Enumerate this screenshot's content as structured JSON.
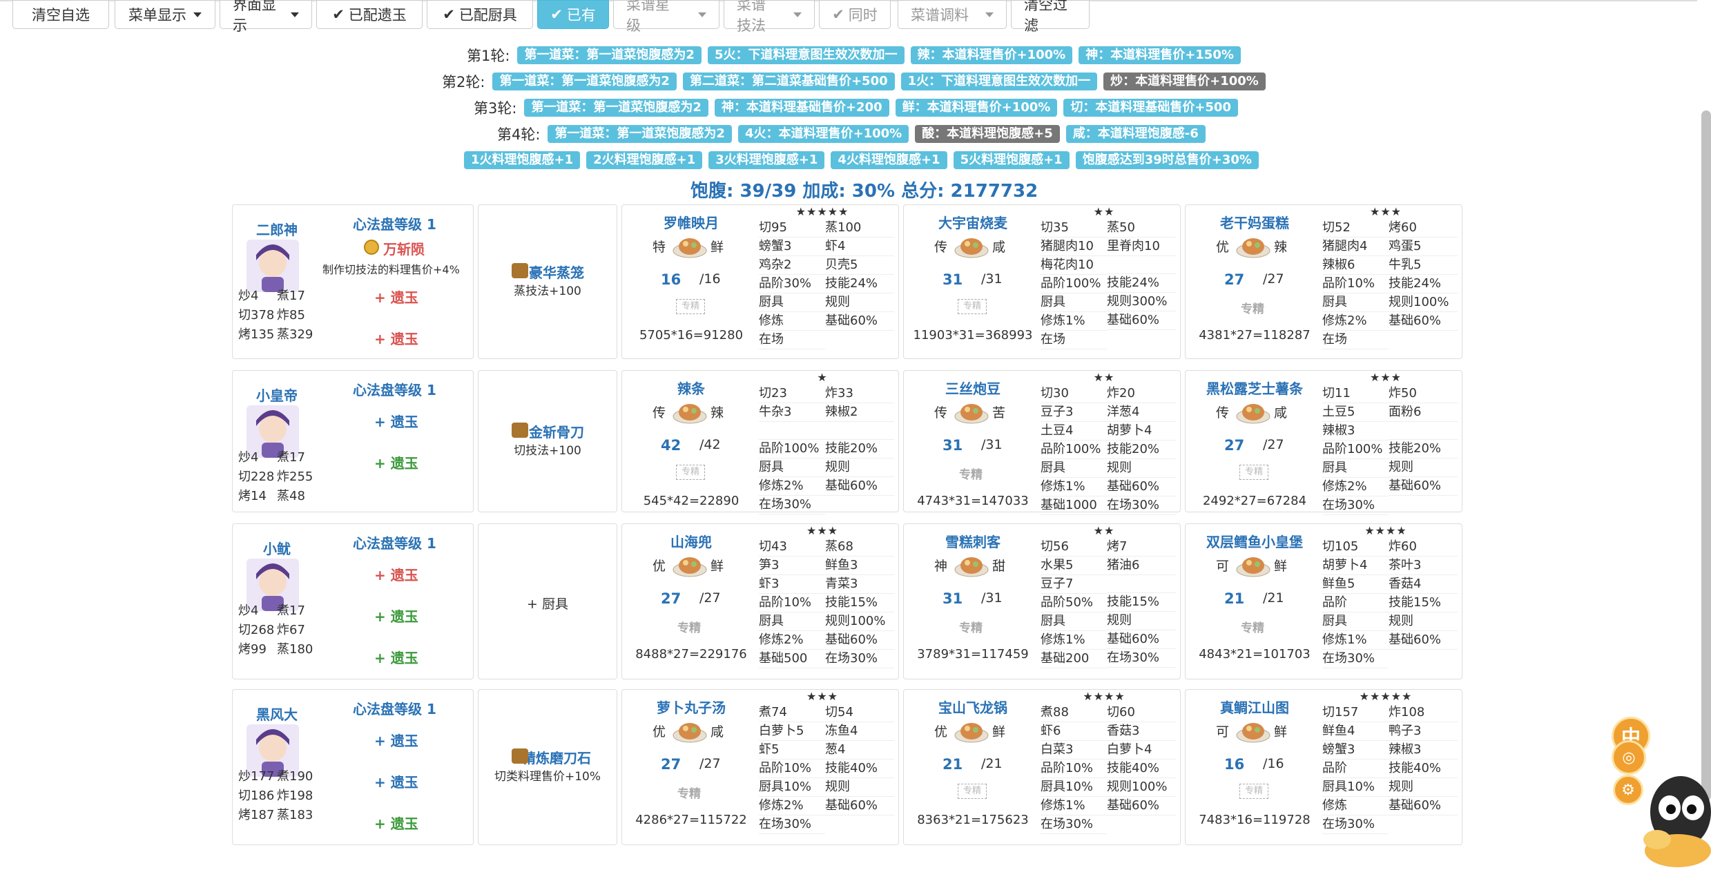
{
  "toolbar": {
    "buttons": [
      {
        "label": "清空自选",
        "type": "plain"
      },
      {
        "label": "菜单显示",
        "type": "dropdown"
      },
      {
        "label": "界面显示",
        "type": "dropdown"
      },
      {
        "label": "已配遗玉",
        "type": "check"
      },
      {
        "label": "已配厨具",
        "type": "check"
      },
      {
        "label": "已有",
        "type": "check-active"
      },
      {
        "label": "菜谱星级",
        "type": "dropdown-disabled"
      },
      {
        "label": "菜谱技法",
        "type": "dropdown-disabled"
      },
      {
        "label": "同时",
        "type": "check-disabled"
      },
      {
        "label": "菜谱调料",
        "type": "dropdown-disabled"
      },
      {
        "label": "清空过滤",
        "type": "plain"
      }
    ]
  },
  "rounds": [
    {
      "label": "第1轮:",
      "tags": [
        {
          "text": "第一道菜：第一道菜饱腹感为2",
          "color": "blue"
        },
        {
          "text": "5火：下道料理意图生效次数加一",
          "color": "blue"
        },
        {
          "text": "辣：本道料理售价+100%",
          "color": "blue"
        },
        {
          "text": "神：本道料理售价+150%",
          "color": "blue"
        }
      ]
    },
    {
      "label": "第2轮:",
      "tags": [
        {
          "text": "第一道菜：第一道菜饱腹感为2",
          "color": "blue"
        },
        {
          "text": "第二道菜：第二道菜基础售价+500",
          "color": "blue"
        },
        {
          "text": "1火：下道料理意图生效次数加一",
          "color": "blue"
        },
        {
          "text": "炒：本道料理售价+100%",
          "color": "gray"
        }
      ]
    },
    {
      "label": "第3轮:",
      "tags": [
        {
          "text": "第一道菜：第一道菜饱腹感为2",
          "color": "blue"
        },
        {
          "text": "神：本道料理基础售价+200",
          "color": "blue"
        },
        {
          "text": "鲜：本道料理售价+100%",
          "color": "blue"
        },
        {
          "text": "切：本道料理基础售价+500",
          "color": "blue"
        }
      ]
    },
    {
      "label": "第4轮:",
      "tags": [
        {
          "text": "第一道菜：第一道菜饱腹感为2",
          "color": "blue"
        },
        {
          "text": "4火：本道料理售价+100%",
          "color": "blue"
        },
        {
          "text": "酸：本道料理饱腹感+5",
          "color": "gray"
        },
        {
          "text": "咸：本道料理饱腹感-6",
          "color": "blue"
        }
      ]
    },
    {
      "label": "",
      "tags": [
        {
          "text": "1火料理饱腹感+1",
          "color": "blue"
        },
        {
          "text": "2火料理饱腹感+1",
          "color": "blue"
        },
        {
          "text": "3火料理饱腹感+1",
          "color": "blue"
        },
        {
          "text": "4火料理饱腹感+1",
          "color": "blue"
        },
        {
          "text": "5火料理饱腹感+1",
          "color": "blue"
        },
        {
          "text": "饱腹感达到39时总售价+30%",
          "color": "blue"
        }
      ]
    }
  ],
  "summary": "饱腹: 39/39 加成: 30% 总分: 2177732",
  "colors": {
    "accent": "#5bc0de",
    "link": "#2a72b5",
    "red": "#d9534f",
    "green": "#3c9a3c",
    "gray_tag": "#777777"
  },
  "rows": [
    {
      "chef": {
        "name": "二郎神",
        "avatar": "chef-erlangshen",
        "xinfa": "心法盘等级 1",
        "skill_name": "万斩陨",
        "skill_desc": "制作切技法的料理售价+4%",
        "stats": [
          [
            "炒4",
            "煮17"
          ],
          [
            "切378",
            "炸85"
          ],
          [
            "烤135",
            "蒸329"
          ]
        ],
        "yuyu": [
          {
            "text": "+ 遗玉",
            "color": "red"
          },
          {
            "text": "+ 遗玉",
            "color": "red"
          }
        ]
      },
      "equip": {
        "name": "豪华蒸笼",
        "desc": "蒸技法+100",
        "icon": "steamer-icon"
      },
      "dishes": [
        {
          "name": "罗帷映月",
          "stars": "★★★★★",
          "rank": "特",
          "flavor": "鲜",
          "qty": "16",
          "max": "/16",
          "zj": "box",
          "total": "5705*16=91280",
          "left": [
            "切95",
            "螃蟹3",
            "鸡杂2",
            "品阶30%",
            "厨具",
            "修炼",
            "在场"
          ],
          "right": [
            "蒸100",
            "虾4",
            "贝壳5",
            "技能24%",
            "规则",
            "基础60%"
          ]
        },
        {
          "name": "大宇宙烧麦",
          "stars": "★★",
          "rank": "传",
          "flavor": "咸",
          "qty": "31",
          "max": "/31",
          "zj": "box",
          "total": "11903*31=368993",
          "left": [
            "切35",
            "猪腿肉10",
            "梅花肉10",
            "品阶100%",
            "厨具",
            "修炼1%",
            "在场"
          ],
          "right": [
            "蒸50",
            "里脊肉10",
            "",
            "技能24%",
            "规则300%",
            "基础60%"
          ]
        },
        {
          "name": "老干妈蛋糕",
          "stars": "★★★",
          "rank": "优",
          "flavor": "辣",
          "qty": "27",
          "max": "/27",
          "zj": "text",
          "total": "4381*27=118287",
          "left": [
            "切52",
            "猪腿肉4",
            "辣椒6",
            "品阶10%",
            "厨具",
            "修炼2%",
            "在场"
          ],
          "right": [
            "烤60",
            "鸡蛋5",
            "牛乳5",
            "技能24%",
            "规则100%",
            "基础60%"
          ]
        }
      ]
    },
    {
      "chef": {
        "name": "小皇帝",
        "avatar": "chef-xiaohuangdi",
        "xinfa": "心法盘等级 1",
        "skill_name": "",
        "skill_desc": "",
        "stats": [
          [
            "炒4",
            "煮17"
          ],
          [
            "切228",
            "炸255"
          ],
          [
            "烤14",
            "蒸48"
          ]
        ],
        "yuyu": [
          {
            "text": "+ 遗玉",
            "color": "blue"
          },
          {
            "text": "+ 遗玉",
            "color": "green"
          }
        ]
      },
      "equip": {
        "name": "金斩骨刀",
        "desc": "切技法+100",
        "icon": "knife-icon"
      },
      "dishes": [
        {
          "name": "辣条",
          "stars": "★",
          "rank": "传",
          "flavor": "辣",
          "qty": "42",
          "max": "/42",
          "zj": "box",
          "total": "545*42=22890",
          "left": [
            "切23",
            "牛杂3",
            "",
            "品阶100%",
            "厨具",
            "修炼2%",
            "在场30%"
          ],
          "right": [
            "炸33",
            "辣椒2",
            "",
            "技能20%",
            "规则",
            "基础60%"
          ]
        },
        {
          "name": "三丝炮豆",
          "stars": "★★",
          "rank": "传",
          "flavor": "苦",
          "qty": "31",
          "max": "/31",
          "zj": "text",
          "total": "4743*31=147033",
          "left": [
            "切30",
            "豆子3",
            "土豆4",
            "品阶100%",
            "厨具",
            "修炼1%",
            "基础1000"
          ],
          "right": [
            "炸20",
            "洋葱4",
            "胡萝卜4",
            "技能20%",
            "规则",
            "基础60%",
            "在场30%"
          ]
        },
        {
          "name": "黑松露芝士薯条",
          "stars": "★★★",
          "rank": "传",
          "flavor": "咸",
          "qty": "27",
          "max": "/27",
          "zj": "box",
          "total": "2492*27=67284",
          "left": [
            "切11",
            "土豆5",
            "辣椒3",
            "品阶100%",
            "厨具",
            "修炼2%",
            "在场30%"
          ],
          "right": [
            "炸50",
            "面粉6",
            "",
            "技能20%",
            "规则",
            "基础60%"
          ]
        }
      ]
    },
    {
      "chef": {
        "name": "小鱿",
        "avatar": "chef-xiaoyou",
        "xinfa": "心法盘等级 1",
        "skill_name": "",
        "skill_desc": "",
        "stats": [
          [
            "炒4",
            "煮17"
          ],
          [
            "切268",
            "炸67"
          ],
          [
            "烤99",
            "蒸180"
          ]
        ],
        "yuyu": [
          {
            "text": "+ 遗玉",
            "color": "red"
          },
          {
            "text": "+ 遗玉",
            "color": "green"
          },
          {
            "text": "+ 遗玉",
            "color": "green"
          }
        ]
      },
      "equip": {
        "name": "",
        "desc": "",
        "icon": "",
        "plus": "+ 厨具"
      },
      "dishes": [
        {
          "name": "山海兜",
          "stars": "★★★",
          "rank": "优",
          "flavor": "鲜",
          "qty": "27",
          "max": "/27",
          "zj": "text",
          "total": "8488*27=229176",
          "left": [
            "切43",
            "笋3",
            "虾3",
            "品阶10%",
            "厨具",
            "修炼2%",
            "基础500"
          ],
          "right": [
            "蒸68",
            "鲜鱼3",
            "青菜3",
            "技能15%",
            "规则100%",
            "基础60%",
            "在场30%"
          ]
        },
        {
          "name": "雪糕刺客",
          "stars": "★★",
          "rank": "神",
          "flavor": "甜",
          "qty": "31",
          "max": "/31",
          "zj": "text",
          "total": "3789*31=117459",
          "left": [
            "切56",
            "水果5",
            "豆子7",
            "品阶50%",
            "厨具",
            "修炼1%",
            "基础200"
          ],
          "right": [
            "烤7",
            "猪油6",
            "",
            "技能15%",
            "规则",
            "基础60%",
            "在场30%"
          ]
        },
        {
          "name": "双层鳕鱼小皇堡",
          "stars": "★★★★",
          "rank": "可",
          "flavor": "鲜",
          "qty": "21",
          "max": "/21",
          "zj": "text",
          "total": "4843*21=101703",
          "left": [
            "切105",
            "胡萝卜4",
            "鲜鱼5",
            "品阶",
            "厨具",
            "修炼1%",
            "在场30%"
          ],
          "right": [
            "炸60",
            "茶叶3",
            "香菇4",
            "技能15%",
            "规则",
            "基础60%"
          ]
        }
      ]
    },
    {
      "chef": {
        "name": "黑风大王",
        "avatar": "chef-heifengdawang",
        "xinfa": "心法盘等级 1",
        "skill_name": "",
        "skill_desc": "",
        "stats": [
          [
            "炒177",
            "煮190"
          ],
          [
            "切186",
            "炸198"
          ],
          [
            "烤187",
            "蒸183"
          ]
        ],
        "yuyu": [
          {
            "text": "+ 遗玉",
            "color": "blue"
          },
          {
            "text": "+ 遗玉",
            "color": "blue"
          },
          {
            "text": "+ 遗玉",
            "color": "green"
          }
        ]
      },
      "equip": {
        "name": "精炼磨刀石",
        "desc": "切类料理售价+10%",
        "icon": "whetstone-icon"
      },
      "dishes": [
        {
          "name": "萝卜丸子汤",
          "stars": "★★★",
          "rank": "优",
          "flavor": "咸",
          "qty": "27",
          "max": "/27",
          "zj": "text",
          "total": "4286*27=115722",
          "left": [
            "煮74",
            "白萝卜5",
            "虾5",
            "品阶10%",
            "厨具10%",
            "修炼2%",
            "在场30%"
          ],
          "right": [
            "切54",
            "冻鱼4",
            "葱4",
            "技能40%",
            "规则",
            "基础60%"
          ]
        },
        {
          "name": "宝山飞龙锅",
          "stars": "★★★★",
          "rank": "优",
          "flavor": "鲜",
          "qty": "21",
          "max": "/21",
          "zj": "box",
          "total": "8363*21=175623",
          "left": [
            "煮88",
            "虾6",
            "白菜3",
            "品阶10%",
            "厨具10%",
            "修炼1%",
            "在场30%"
          ],
          "right": [
            "切60",
            "香菇3",
            "白萝卜4",
            "技能40%",
            "规则100%",
            "基础60%"
          ]
        },
        {
          "name": "真鲷江山图",
          "stars": "★★★★★",
          "rank": "可",
          "flavor": "鲜",
          "qty": "16",
          "max": "/16",
          "zj": "box",
          "total": "7483*16=119728",
          "left": [
            "切157",
            "鲜鱼4",
            "螃蟹3",
            "品阶",
            "厨具10%",
            "修炼",
            "在场30%"
          ],
          "right": [
            "炸108",
            "鸭子3",
            "辣椒3",
            "技能40%",
            "规则",
            "基础60%"
          ]
        }
      ]
    }
  ],
  "zj_label": "专精",
  "widgets": {
    "lang": "中"
  }
}
